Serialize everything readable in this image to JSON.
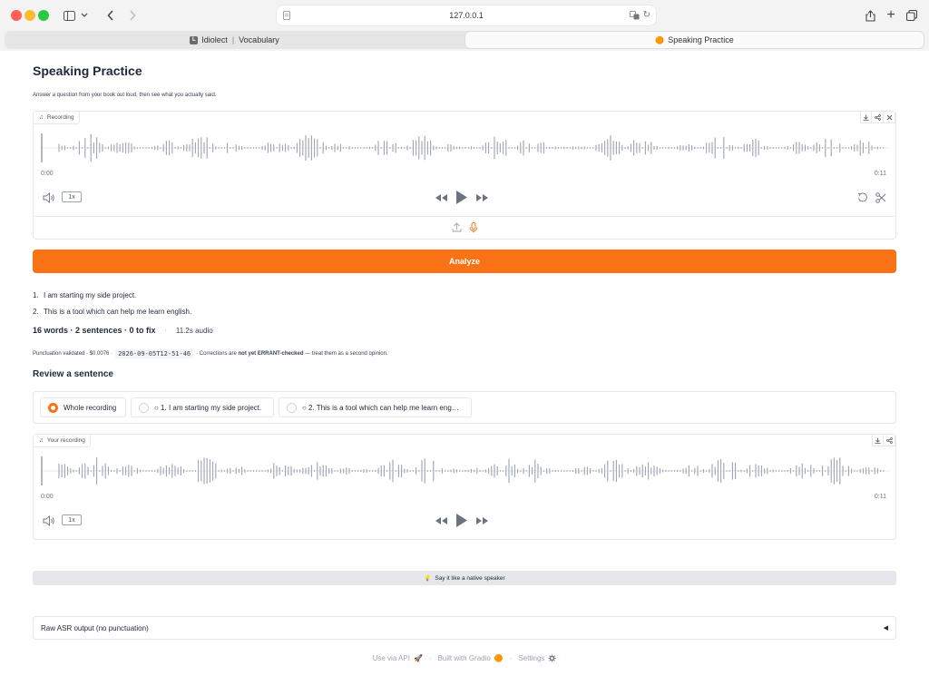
{
  "browser": {
    "url": "127.0.0.1",
    "tabs": [
      {
        "favicon": "L",
        "title": "Idiolect",
        "subtitle": "Vocabulary"
      },
      {
        "emoji": "🟠",
        "title": "Speaking Practice"
      }
    ]
  },
  "page": {
    "title": "Speaking Practice",
    "description": "Answer a question from your book out loud, then see what you actually said."
  },
  "recording": {
    "label": "Recording",
    "time_start": "0:00",
    "time_end": "0:11",
    "speed": "1x"
  },
  "analyze": {
    "label": "Analyze"
  },
  "sentences": [
    {
      "num": "1.",
      "text": "I am starting my side project."
    },
    {
      "num": "2.",
      "text": "This is a tool which can help me learn english."
    }
  ],
  "stats": {
    "summary": "16 words · 2 sentences · 0 to fix",
    "separator": "·",
    "audio": "11.2s audio"
  },
  "note": {
    "prefix": "Punctuation validated · $0.0076 ·",
    "code": "2026-09-05T12-51-46",
    "middle": "· Corrections are",
    "bold": "not yet ERRANT-checked",
    "suffix": "— treat them as a second opinion."
  },
  "review": {
    "title": "Review a sentence",
    "options": [
      {
        "label": "Whole recording",
        "checked": true
      },
      {
        "label": "○ 1. I am starting my side project.",
        "checked": false
      },
      {
        "label": "○ 2. This is a tool which can help me learn eng…",
        "checked": false
      }
    ]
  },
  "your_recording": {
    "label": "Your recording",
    "time_start": "0:00",
    "time_end": "0:11",
    "speed": "1x"
  },
  "native": {
    "emoji": "💡",
    "label": "Say it like a native speaker"
  },
  "raw_asr": {
    "label": "Raw ASR output (no punctuation)",
    "arrow": "◀"
  },
  "footer": {
    "api": "Use via API",
    "built": "Built with Gradio",
    "settings": "Settings",
    "dot": "·"
  },
  "colors": {
    "accent": "#f97316",
    "waveform": "#9ca3af"
  }
}
